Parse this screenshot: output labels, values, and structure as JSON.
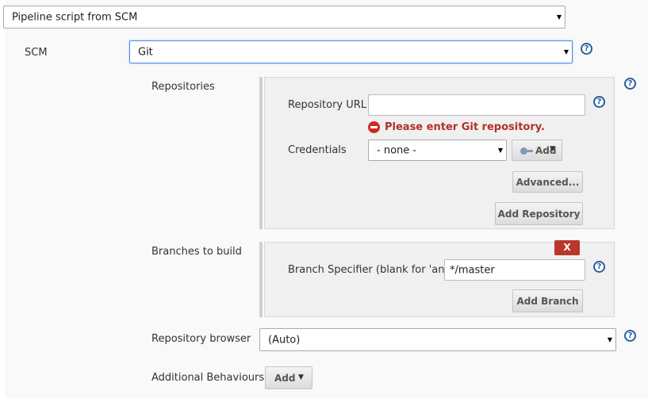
{
  "definition_select": {
    "value": "Pipeline script from SCM"
  },
  "scm": {
    "label": "SCM",
    "value": "Git"
  },
  "repositories": {
    "label": "Repositories",
    "url_label": "Repository URL",
    "url_value": "",
    "error": "Please enter Git repository.",
    "credentials_label": "Credentials",
    "credentials_value": "- none -",
    "add_label": "Add",
    "advanced_label": "Advanced...",
    "add_repository_label": "Add Repository"
  },
  "branches": {
    "label": "Branches to build",
    "delete_label": "X",
    "specifier_label": "Branch Specifier (blank for 'any')",
    "specifier_value": "*/master",
    "add_branch_label": "Add Branch"
  },
  "repository_browser": {
    "label": "Repository browser",
    "value": "(Auto)"
  },
  "additional_behaviours": {
    "label": "Additional Behaviours",
    "add_label": "Add"
  },
  "help_icon_glyph": "?",
  "colors": {
    "error": "#b0302a",
    "help": "#2a5d9f",
    "focus": "#4a8ef0",
    "delete": "#b8372c"
  }
}
